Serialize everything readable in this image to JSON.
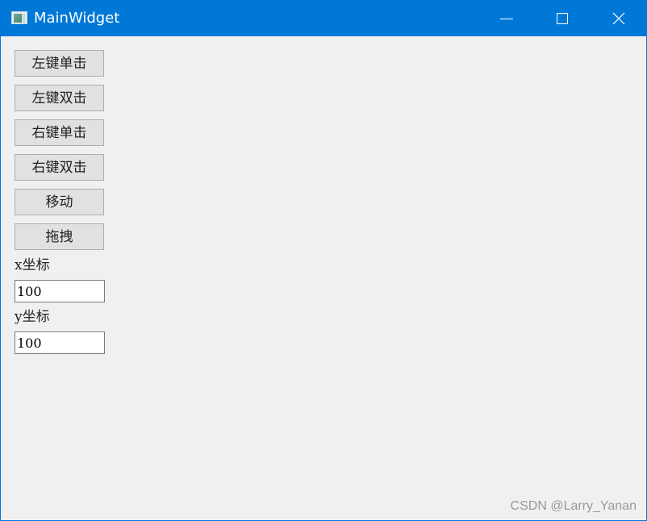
{
  "window": {
    "title": "MainWidget",
    "accent_color": "#0078d7",
    "icons": {
      "app": "app-window-icon",
      "minimize": "minimize-icon",
      "maximize": "maximize-icon",
      "close": "close-icon"
    },
    "close_glyph": "✕"
  },
  "buttons": [
    {
      "label": "左键单击"
    },
    {
      "label": "左键双击"
    },
    {
      "label": "右键单击"
    },
    {
      "label": "右键双击"
    },
    {
      "label": "移动"
    },
    {
      "label": "拖拽"
    }
  ],
  "coords": {
    "x_label": "x坐标",
    "x_value": "100",
    "y_label": "y坐标",
    "y_value": "100"
  },
  "watermark": "CSDN @Larry_Yanan"
}
